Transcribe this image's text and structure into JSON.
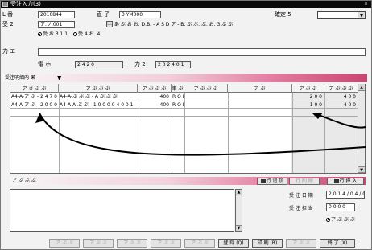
{
  "window": {
    "title": "受注入力(3)",
    "close": "×"
  },
  "header": {
    "row1": {
      "label_a": "L 番",
      "value_a": "2010844",
      "label_b": "直 子",
      "value_b": "3 YM000",
      "label_c": "確定 5",
      "dropdown_value": ""
    },
    "row2": {
      "label": "受 2",
      "code": "ア.ソ.001",
      "lookup": "…",
      "name": "あ ぶ お お. D.B. - A S D ア - B. ぶ ぶ. ぶ. お. 3 ぶ ぶ"
    },
    "radios": [
      {
        "label": "受 お 3 1 1",
        "checked": true
      },
      {
        "label": "受 4 お. 4",
        "checked": false
      }
    ],
    "row3": {
      "label": "力 エ",
      "value": ""
    },
    "row4": {
      "label_a": "電 ホ",
      "value_a": "2 4 2 0",
      "label_b": "力 2",
      "value_b": "2 0 2 4 0 1"
    }
  },
  "detail": {
    "section_label": "受注明細内 果",
    "toggle": "▼",
    "columns": [
      "ア さ ぶ ぶ",
      "ア ぶ ぶ ぶ",
      "ア ぶ ぶ ぶ",
      "単 ぶ",
      "ア ぶ ぶ ぶ",
      "ア ぶ",
      "ア ぶ ぶ",
      "ア ぶ ぶ ぶ"
    ],
    "rows": [
      [
        "A4-A-ア ぶ - 2 4 7 0 0 1",
        "A4-A-ぶ ぶ ぶ - A ぶ ぶ ぶ",
        "400",
        "R O L",
        "",
        "",
        "2 0 0",
        "4 0 0"
      ],
      [
        "A4-A-ア ぶ - 2 0 0 0",
        "A4-A-A ぶ ぶ - 1 0 0 0 0 4 0 0 1",
        "400",
        "R O L",
        "",
        "",
        "1 0 0",
        "4 0 0"
      ]
    ]
  },
  "actions": {
    "left_label": "ア ぶ ぶ ぶ",
    "add_label": "行 追 加",
    "delete_label": "行 削 除",
    "insert_label": "行 挿 入"
  },
  "memo": {
    "value": "",
    "label_date": "受 注 日 期",
    "value_date": "2 0 1 4 / 0 4 / 0 4",
    "label_person": "受 注 担 当",
    "value_person": "0 0 0 0",
    "radio_label": "ア ぶ ぶ ぶ"
  },
  "buttons": [
    "ア ぶ ぶ",
    "ア ぶ ぶ",
    "ア ぶ ぶ",
    "ア ぶ ぶ",
    "ア ぶ ぶ",
    "登 録 (Q)",
    "印 刷 (R)",
    "ア ぶ ぶ",
    "終 了 (X)"
  ],
  "colors": {
    "accent": "#c8466f",
    "titlebar": "#0a0a0a"
  }
}
